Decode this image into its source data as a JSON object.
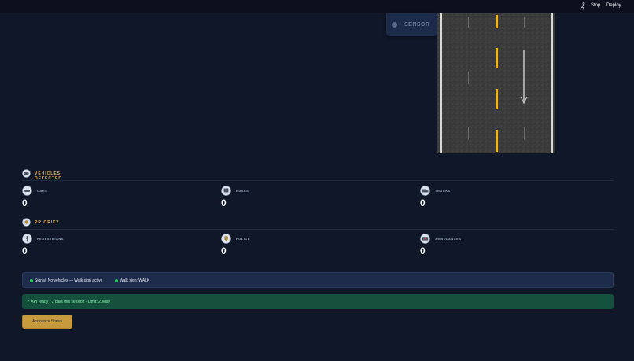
{
  "topbar": {
    "stop_label": "Stop",
    "deploy_label": "Deploy",
    "run_icon": "running-figure-icon"
  },
  "sensor": {
    "label": "SENSOR"
  },
  "vehicles": {
    "title": "VEHICLES DETECTED",
    "items": [
      {
        "label": "CARS",
        "value": "0",
        "icon": "car-icon"
      },
      {
        "label": "BUSES",
        "value": "0",
        "icon": "bus-icon"
      },
      {
        "label": "TRUCKS",
        "value": "0",
        "icon": "truck-icon"
      }
    ]
  },
  "priority": {
    "title": "PRIORITY",
    "items": [
      {
        "label": "PEDESTRIANS",
        "value": "0",
        "icon": "pedestrian-icon"
      },
      {
        "label": "POLICE",
        "value": "0",
        "icon": "police-icon"
      },
      {
        "label": "AMBULANCES",
        "value": "0",
        "icon": "ambulance-icon"
      }
    ]
  },
  "status": {
    "signal_key": "Signal:",
    "signal_value": "No vehicles — Walk sign active",
    "walk_key": "Walk sign:",
    "walk_value": "WALK",
    "indicator_color": "#22c55e"
  },
  "api": {
    "message": "✓ API ready · 2 calls this session · Limit: 20/day"
  },
  "announce": {
    "label": "Announce Status"
  },
  "colors": {
    "accent": "#e0b35c",
    "background": "#0f1729",
    "button": "#c89a3e"
  }
}
